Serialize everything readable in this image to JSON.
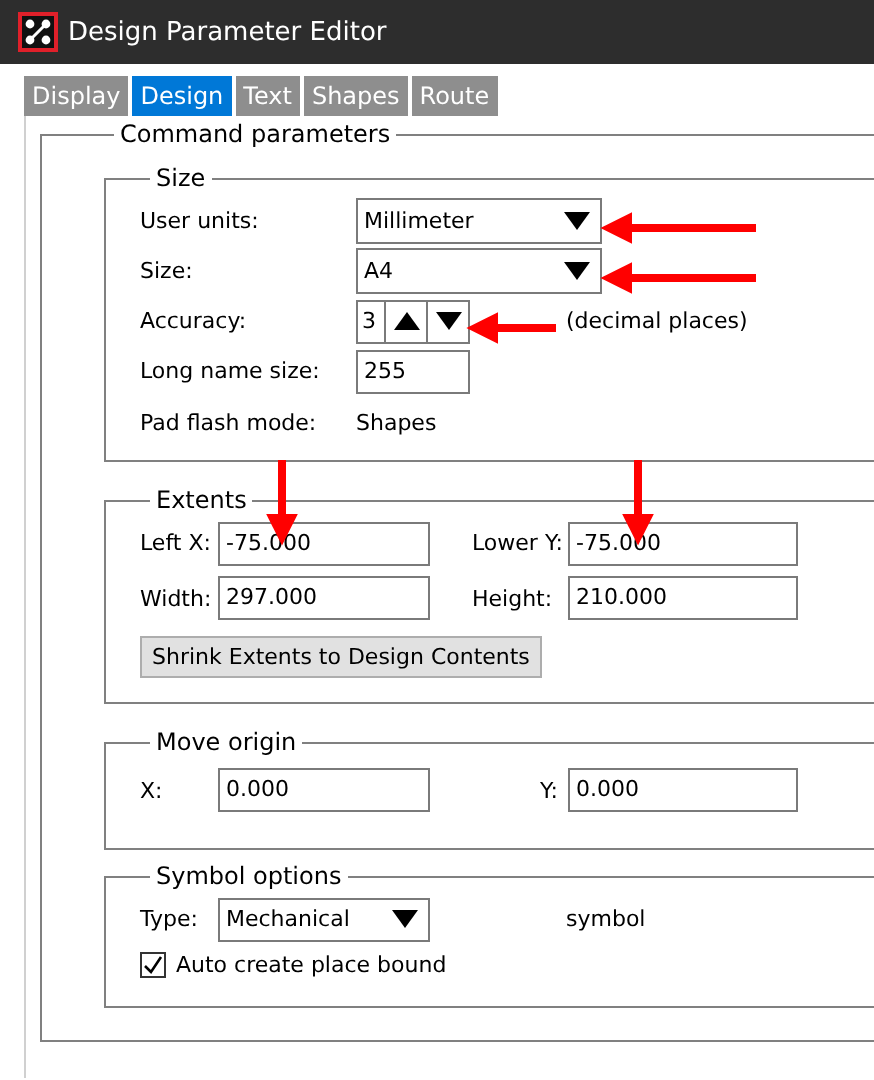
{
  "window": {
    "title": "Design Parameter Editor"
  },
  "tabs": [
    {
      "label": "Display",
      "selected": false
    },
    {
      "label": "Design",
      "selected": true
    },
    {
      "label": "Text",
      "selected": false
    },
    {
      "label": "Shapes",
      "selected": false
    },
    {
      "label": "Route",
      "selected": false
    }
  ],
  "panel": {
    "title": "Command parameters",
    "groups": [
      {
        "kind": "size",
        "title": "Size",
        "rows": [
          {
            "items": [
              {
                "kind": "label",
                "text": "User units:"
              },
              {
                "kind": "dropdown",
                "value": "Millimeter"
              }
            ]
          },
          {
            "items": [
              {
                "kind": "label",
                "text": "Size:"
              },
              {
                "kind": "dropdown",
                "value": "A4"
              }
            ]
          },
          {
            "items": [
              {
                "kind": "label",
                "text": "Accuracy:"
              },
              {
                "kind": "spinner",
                "value": "3"
              },
              {
                "kind": "note",
                "text": "(decimal places)"
              }
            ]
          },
          {
            "items": [
              {
                "kind": "label",
                "text": "Long name size:"
              },
              {
                "kind": "input",
                "value": "255"
              }
            ]
          },
          {
            "items": [
              {
                "kind": "label",
                "text": "Pad flash mode:"
              },
              {
                "kind": "note",
                "text": "Shapes"
              }
            ]
          }
        ]
      },
      {
        "kind": "extents",
        "title": "Extents",
        "rows": [
          {
            "items": [
              {
                "kind": "label",
                "text": "Left X:"
              },
              {
                "kind": "input",
                "value": "-75.000"
              },
              {
                "kind": "gap"
              },
              {
                "kind": "label",
                "text": "Lower Y:"
              },
              {
                "kind": "input",
                "value": "-75.000"
              }
            ]
          },
          {
            "items": [
              {
                "kind": "label",
                "text": "Width:"
              },
              {
                "kind": "input",
                "value": "297.000"
              },
              {
                "kind": "gap"
              },
              {
                "kind": "label",
                "text": "Height:"
              },
              {
                "kind": "input",
                "value": "210.000"
              }
            ]
          },
          {
            "items": [
              {
                "kind": "button",
                "label": "Shrink Extents to Design Contents"
              }
            ]
          }
        ]
      },
      {
        "kind": "origin",
        "title": "Move origin",
        "rows": [
          {
            "items": [
              {
                "kind": "label",
                "text": "X:"
              },
              {
                "kind": "input",
                "value": "0.000"
              },
              {
                "kind": "gap"
              },
              {
                "kind": "label",
                "text": "Y:"
              },
              {
                "kind": "input",
                "value": "0.000"
              }
            ]
          }
        ]
      },
      {
        "kind": "symbol",
        "title": "Symbol options",
        "rows": [
          {
            "items": [
              {
                "kind": "label",
                "text": "Type:"
              },
              {
                "kind": "dropdown",
                "value": "Mechanical"
              },
              {
                "kind": "gap"
              },
              {
                "kind": "note",
                "text": "symbol"
              }
            ]
          },
          {
            "items": [
              {
                "kind": "checkbox",
                "label": "Auto create place bound",
                "checked": true
              }
            ]
          }
        ]
      }
    ]
  }
}
